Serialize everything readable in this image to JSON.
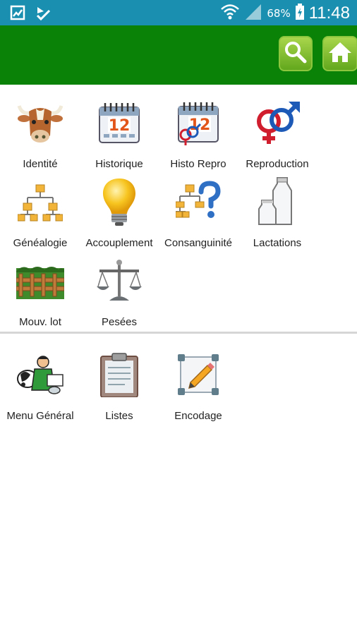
{
  "status_bar": {
    "left_icons": [
      "gallery-icon",
      "download-check-icon"
    ],
    "right_icons": [
      "wifi-icon",
      "signal-icon",
      "battery-charging-icon"
    ],
    "battery": "68%",
    "time": "11:48",
    "color": "#1b8fb0"
  },
  "app_bar": {
    "color": "#0a8107",
    "actions": [
      {
        "name": "search-button",
        "icon": "magnifier-icon"
      },
      {
        "name": "home-button",
        "icon": "home-icon"
      }
    ]
  },
  "menu_main": [
    {
      "label": "Identité",
      "icon": "cow-head-icon"
    },
    {
      "label": "Historique",
      "icon": "calendar-icon"
    },
    {
      "label": "Histo Repro",
      "icon": "calendar-gender-icon"
    },
    {
      "label": "Reproduction",
      "icon": "gender-symbols-icon"
    },
    {
      "label": "Généalogie",
      "icon": "family-tree-icon"
    },
    {
      "label": "Accouplement",
      "icon": "light-bulb-icon"
    },
    {
      "label": "Consanguinité",
      "icon": "tree-question-icon"
    },
    {
      "label": "Lactations",
      "icon": "milk-bottles-icon"
    },
    {
      "label": "Mouv. lot",
      "icon": "field-fence-icon"
    },
    {
      "label": "Pesées",
      "icon": "scale-icon"
    }
  ],
  "menu_secondary": [
    {
      "label": "Menu Général",
      "icon": "farmer-menu-icon"
    },
    {
      "label": "Listes",
      "icon": "clipboard-icon"
    },
    {
      "label": "Encodage",
      "icon": "edit-pencil-icon"
    }
  ]
}
